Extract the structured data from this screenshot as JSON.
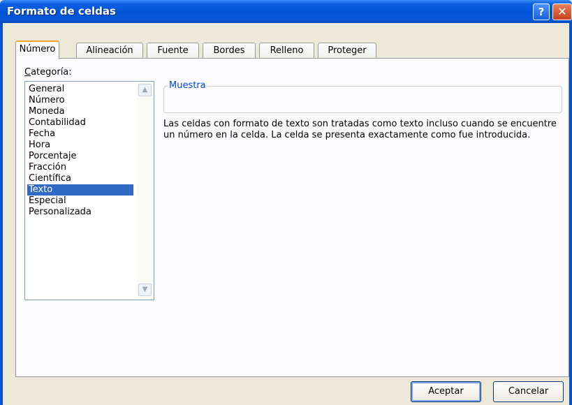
{
  "window": {
    "title": "Formato de celdas",
    "help_glyph": "?",
    "close_glyph": "✕"
  },
  "tabs": [
    {
      "label": "Número",
      "active": true
    },
    {
      "label": "Alineación",
      "active": false
    },
    {
      "label": "Fuente",
      "active": false
    },
    {
      "label": "Bordes",
      "active": false
    },
    {
      "label": "Relleno",
      "active": false
    },
    {
      "label": "Proteger",
      "active": false
    }
  ],
  "category": {
    "label_accel": "C",
    "label_rest": "ategoría:",
    "items": [
      "General",
      "Número",
      "Moneda",
      "Contabilidad",
      "Fecha",
      "Hora",
      "Porcentaje",
      "Fracción",
      "Científica",
      "Texto",
      "Especial",
      "Personalizada"
    ],
    "selected": "Texto"
  },
  "sample": {
    "title": "Muestra",
    "value": ""
  },
  "description": "Las celdas con formato de texto son tratadas como texto incluso cuando se encuentre un número en la celda. La celda se presenta exactamente como fue introducida.",
  "buttons": {
    "ok": "Aceptar",
    "cancel": "Cancelar"
  },
  "colors": {
    "titlebar": "#0052d4",
    "selection": "#316ac5",
    "group_title": "#0046d5",
    "active_tab_accent": "#f5a623"
  }
}
